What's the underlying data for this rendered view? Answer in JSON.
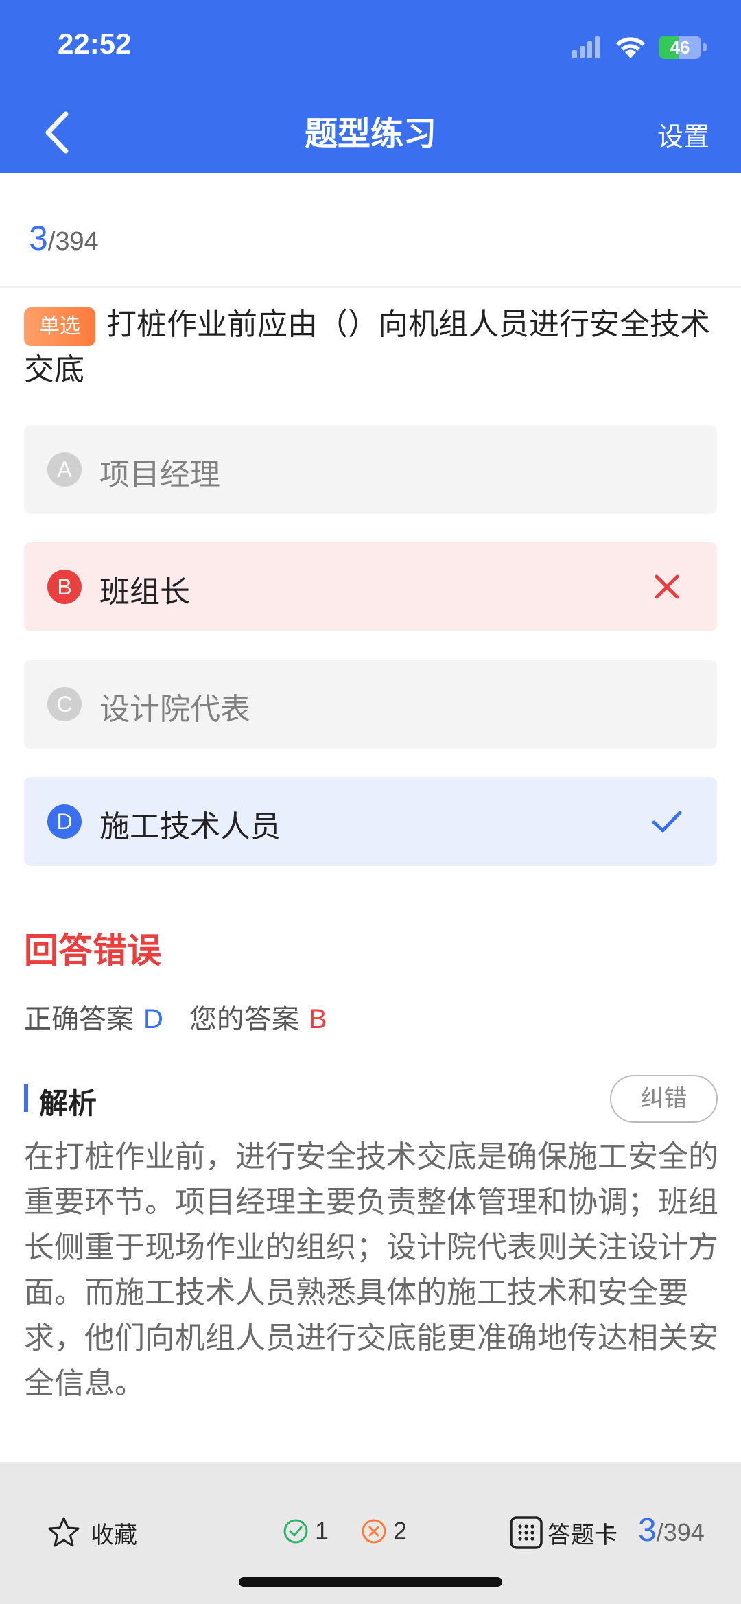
{
  "status_bar": {
    "time": "22:52",
    "battery": "46",
    "battery_level": 0.46,
    "icons": [
      "signal-icon",
      "wifi-icon",
      "battery-charging-icon"
    ]
  },
  "nav": {
    "back_icon": "chevron-left-icon",
    "title": "题型练习",
    "settings_label": "设置"
  },
  "progress": {
    "current": "3",
    "total": "/394"
  },
  "question": {
    "type_badge": "单选",
    "text": "打桩作业前应由（）向机组人员进行安全技术交底"
  },
  "options": [
    {
      "letter": "A",
      "text": "项目经理",
      "state": "normal"
    },
    {
      "letter": "B",
      "text": "班组长",
      "state": "wrong",
      "mark_icon": "x-icon"
    },
    {
      "letter": "C",
      "text": "设计院代表",
      "state": "normal"
    },
    {
      "letter": "D",
      "text": "施工技术人员",
      "state": "correct",
      "mark_icon": "checkmark-icon"
    }
  ],
  "result": {
    "title": "回答错误",
    "correct_label": "正确答案",
    "correct_value": "D",
    "yours_label": "您的答案",
    "yours_value": "B"
  },
  "analysis": {
    "title": "解析",
    "report_label": "纠错",
    "text": "在打桩作业前，进行安全技术交底是确保施工安全的重要环节。项目经理主要负责整体管理和协调；班组长侧重于现场作业的组织；设计院代表则关注设计方面。而施工技术人员熟悉具体的施工技术和安全要求，他们向机组人员进行交底能更准确地传达相关安全信息。"
  },
  "bottom_bar": {
    "favorite_label": "收藏",
    "correct_count": "1",
    "wrong_count": "2",
    "answer_card_label": "答题卡",
    "progress_current": "3",
    "progress_total": "/394"
  },
  "colors": {
    "primary": "#3a6ff0",
    "error": "#ea3f3f",
    "badge": "#ff7a3b",
    "success": "#2fb36b"
  }
}
